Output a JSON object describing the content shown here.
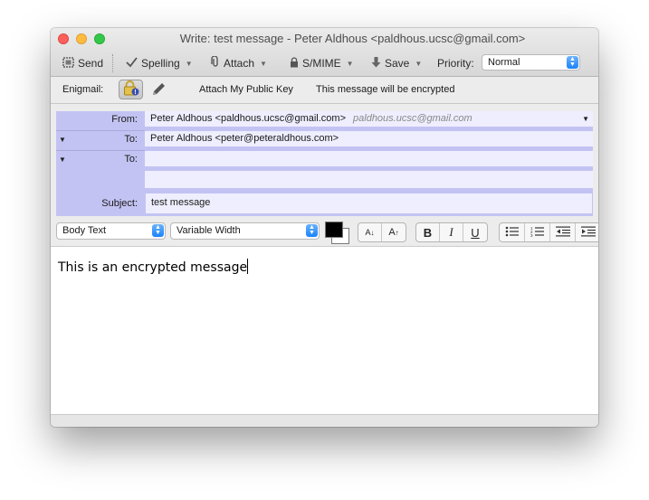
{
  "window": {
    "title": "Write: test message - Peter Aldhous <paldhous.ucsc@gmail.com>"
  },
  "toolbar": {
    "send_label": "Send",
    "spelling_label": "Spelling",
    "attach_label": "Attach",
    "smime_label": "S/MIME",
    "save_label": "Save",
    "priority_label": "Priority:",
    "priority_value": "Normal"
  },
  "enigmail": {
    "label": "Enigmail:",
    "attach_key_label": "Attach My Public Key",
    "status_text": "This message will be encrypted"
  },
  "headers": {
    "from_label": "From:",
    "from_value": "Peter Aldhous <paldhous.ucsc@gmail.com>",
    "from_alt": "paldhous.ucsc@gmail.com",
    "to_label": "To:",
    "to_value": "Peter Aldhous <peter@peteraldhous.com>",
    "to2_label": "To:",
    "to2_value": "",
    "subject_label": "Subject:",
    "subject_value": "test message"
  },
  "format": {
    "paragraph_style": "Body Text",
    "font": "Variable Width",
    "smaller_label": "A",
    "larger_label": "A",
    "bold_label": "B",
    "italic_label": "I",
    "underline_label": "U"
  },
  "editor": {
    "body": "This is an encrypted message"
  },
  "colors": {
    "header_label_bg": "#c3c3f3",
    "header_field_bg": "#eeeeff",
    "accent": "#1a82fb"
  }
}
